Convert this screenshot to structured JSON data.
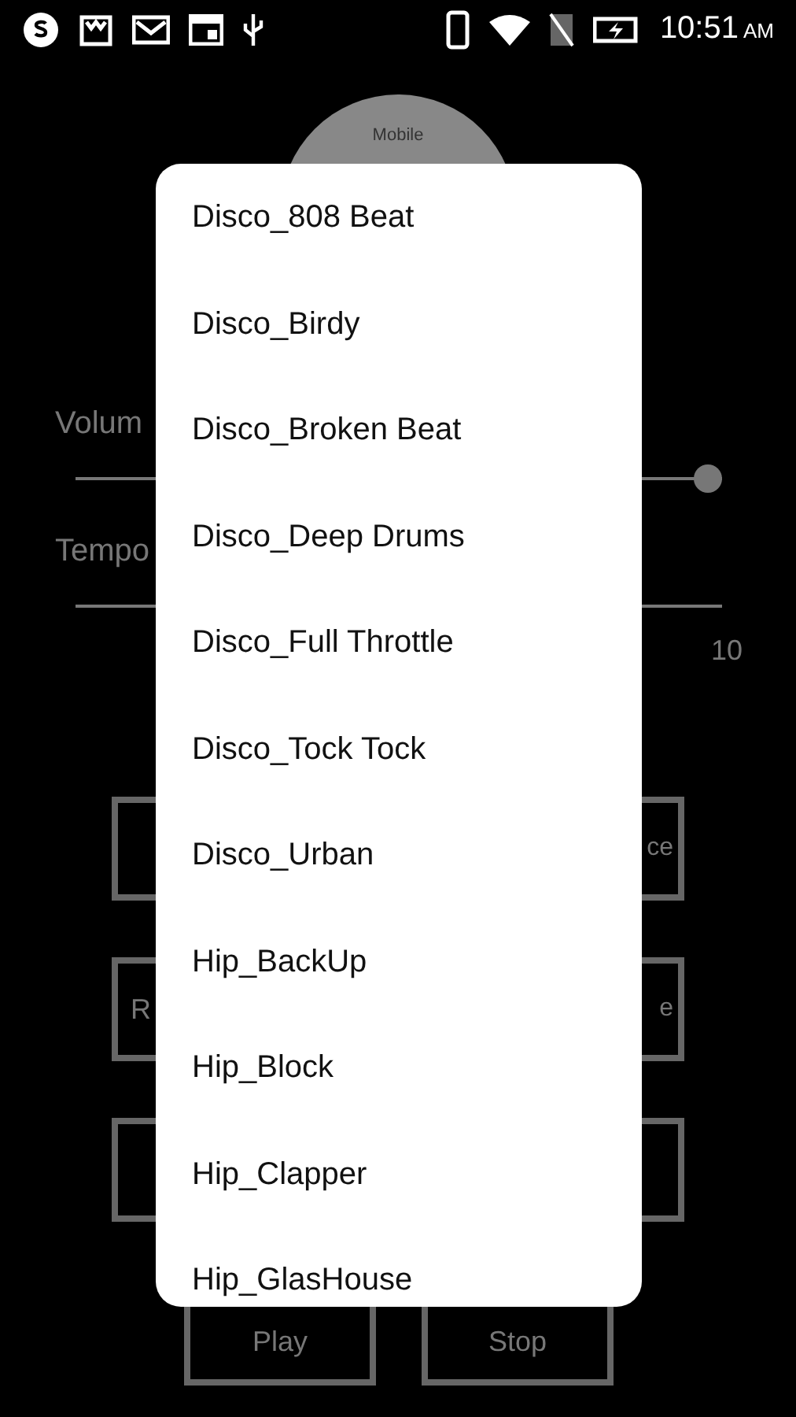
{
  "status_bar": {
    "time": "10:51",
    "ampm": "AM"
  },
  "logo": {
    "text": "Mobile"
  },
  "sliders": [
    {
      "label": "Volum",
      "level": 1
    },
    {
      "label": "Tempo",
      "value": "10"
    }
  ],
  "button_rows": [
    {
      "right_label": "ce"
    },
    {
      "left_label": "R",
      "right_label": "e"
    },
    {}
  ],
  "bottom_buttons": [
    "Play",
    "Stop"
  ],
  "dialog": {
    "items": [
      "Disco_808 Beat",
      "Disco_Birdy",
      "Disco_Broken Beat",
      "Disco_Deep Drums",
      "Disco_Full Throttle",
      "Disco_Tock Tock",
      "Disco_Urban",
      "Hip_BackUp",
      "Hip_Block",
      "Hip_Clapper",
      "Hip_GlasHouse"
    ]
  }
}
